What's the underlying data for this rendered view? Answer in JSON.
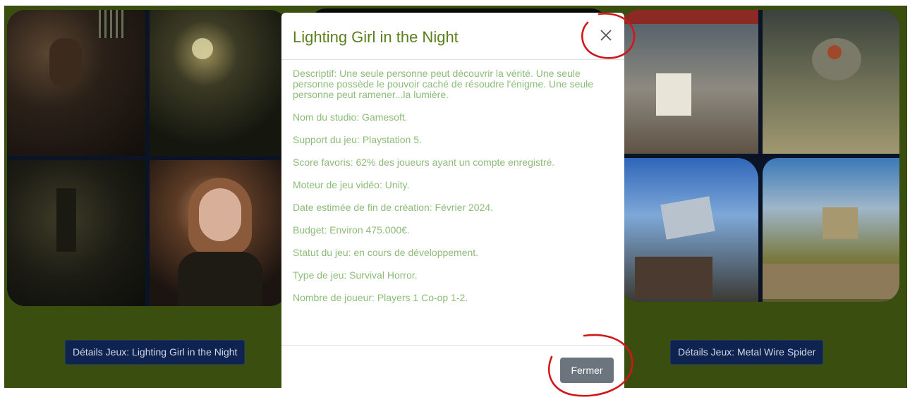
{
  "cards": {
    "left": {
      "button_label": "Détails Jeux: Lighting Girl in the Night"
    },
    "right": {
      "button_label": "Détails Jeux: Metal Wire Spider"
    }
  },
  "modal": {
    "title": "Lighting Girl in the Night",
    "close_icon": "close-icon",
    "fields": [
      "Descriptif: Une seule personne peut découvrir la vérité. Une seule personne possède le pouvoir caché de résoudre l'énigme. Une seule personne peut ramener...la lumière.",
      "Nom du studio: Gamesoft.",
      "Support du jeu: Playstation 5.",
      "Score favoris: 62% des joueurs ayant un compte enregistré.",
      "Moteur de jeu vidéo: Unity.",
      "Date estimée de fin de création: Février 2024.",
      "Budget: Environ 475.000€.",
      "Statut du jeu: en cours de développement.",
      "Type de jeu: Survival Horror.",
      "Nombre de joueur: Players 1 Co-op 1-2."
    ],
    "close_button_label": "Fermer"
  },
  "colors": {
    "page_background": "#3a4e10",
    "title": "#5a7f1c",
    "body_text": "#8cbc78",
    "details_button": "#0f2350",
    "close_button": "#6c757d",
    "annotation": "#d01818"
  }
}
